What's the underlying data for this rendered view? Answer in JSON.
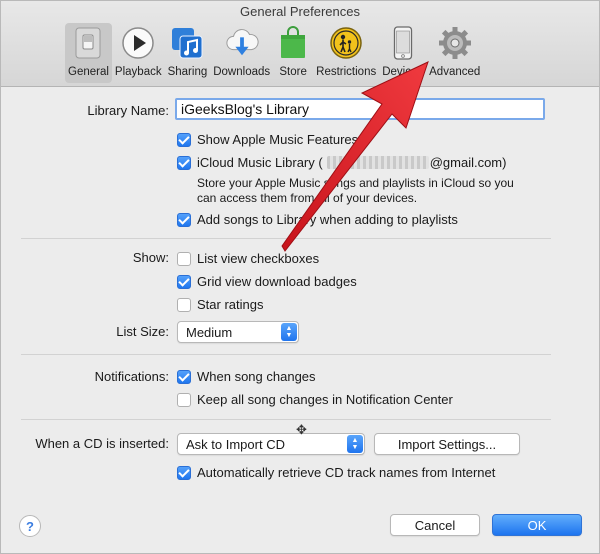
{
  "window": {
    "title": "General Preferences"
  },
  "toolbar": {
    "items": [
      {
        "label": "General",
        "icon": "general-switch-icon",
        "selected": true
      },
      {
        "label": "Playback",
        "icon": "play-icon"
      },
      {
        "label": "Sharing",
        "icon": "sharing-music-icon"
      },
      {
        "label": "Downloads",
        "icon": "cloud-download-icon"
      },
      {
        "label": "Store",
        "icon": "store-bag-icon"
      },
      {
        "label": "Restrictions",
        "icon": "restrictions-parental-icon"
      },
      {
        "label": "Devices",
        "icon": "iphone-device-icon"
      },
      {
        "label": "Advanced",
        "icon": "gear-icon"
      }
    ]
  },
  "library": {
    "label": "Library Name:",
    "value": "iGeeksBlog's Library",
    "show_apple_music": "Show Apple Music Features",
    "icloud_prefix": "iCloud Music Library (",
    "icloud_suffix": "@gmail.com)",
    "icloud_note_line1": "Store your Apple Music songs and playlists in iCloud so you",
    "icloud_note_line2": "can access them from all of your devices.",
    "add_songs": "Add songs to Library when adding to playlists"
  },
  "show": {
    "label": "Show:",
    "list_view_checkboxes": "List view checkboxes",
    "grid_view_badges": "Grid view download badges",
    "star_ratings": "Star ratings"
  },
  "list_size": {
    "label": "List Size:",
    "value": "Medium"
  },
  "notifications": {
    "label": "Notifications:",
    "when_song_changes": "When song changes",
    "keep_all": "Keep all song changes in Notification Center"
  },
  "cd": {
    "label": "When a CD is inserted:",
    "value": "Ask to Import CD",
    "import_settings": "Import Settings...",
    "auto_retrieve": "Automatically retrieve CD track names from Internet"
  },
  "footer": {
    "help": "?",
    "cancel": "Cancel",
    "ok": "OK"
  },
  "colors": {
    "accent": "#1f76ef",
    "annotation_arrow": "#e8202a"
  }
}
